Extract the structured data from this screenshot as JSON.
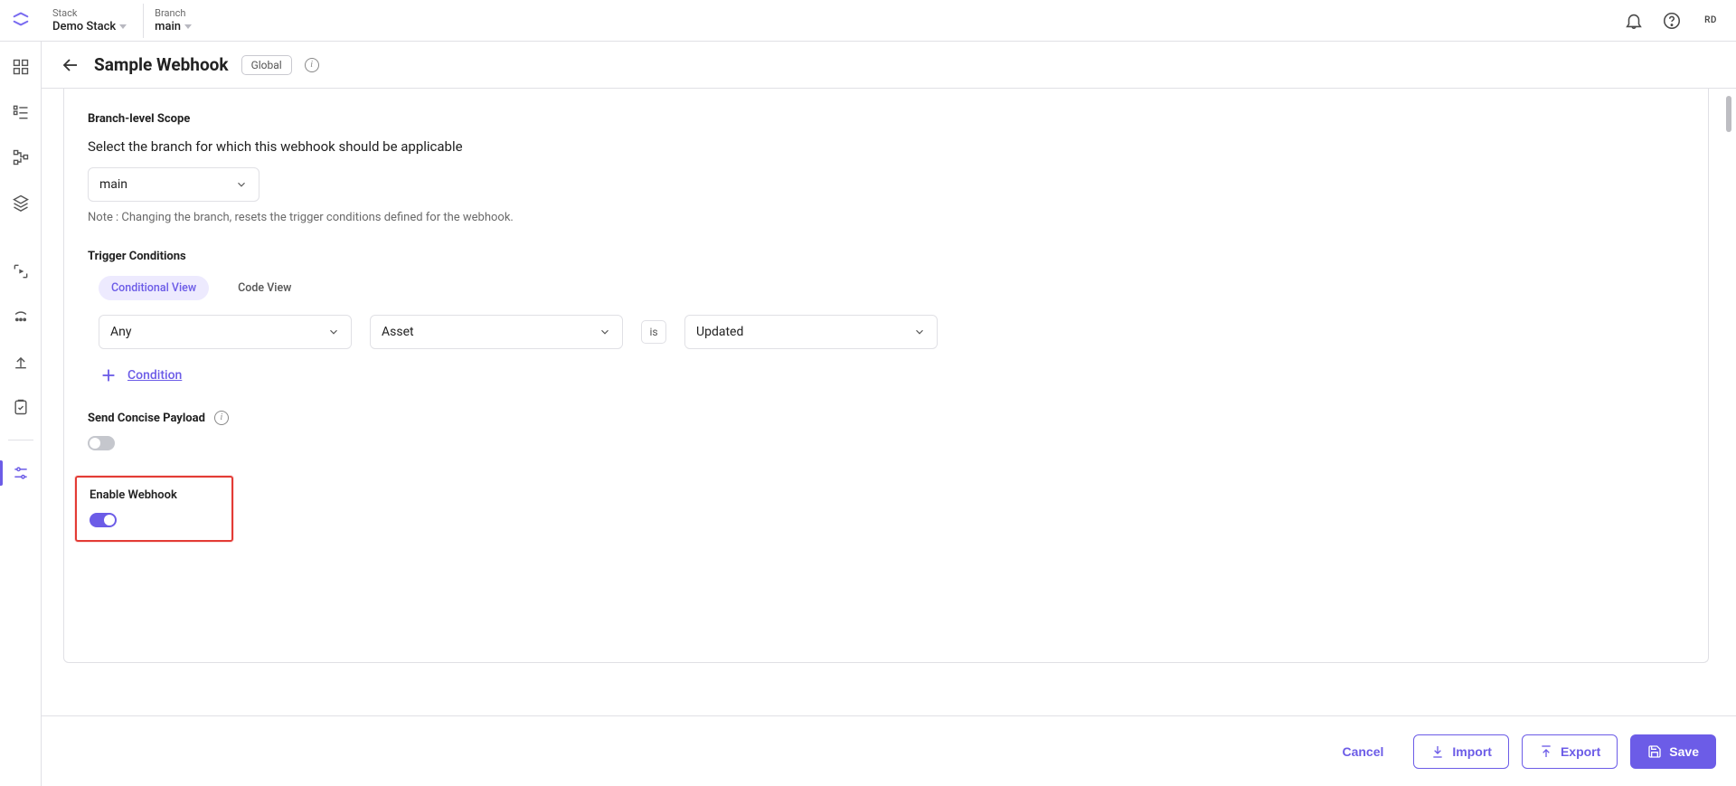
{
  "topbar": {
    "stack_label": "Stack",
    "stack_value": "Demo Stack",
    "branch_label": "Branch",
    "branch_value": "main",
    "avatar_initials": "RD"
  },
  "header": {
    "title": "Sample Webhook",
    "scope_badge": "Global"
  },
  "branch_scope": {
    "title": "Branch-level Scope",
    "description": "Select the branch for which this webhook should be applicable",
    "selected": "main",
    "note": "Note : Changing the branch, resets the trigger conditions defined for the webhook."
  },
  "trigger": {
    "title": "Trigger Conditions",
    "tabs": {
      "conditional": "Conditional View",
      "code": "Code View"
    },
    "row": {
      "scope": "Any",
      "entity": "Asset",
      "op": "is",
      "action": "Updated"
    },
    "add_label": "Condition"
  },
  "concise": {
    "title": "Send Concise Payload",
    "enabled": false
  },
  "enable": {
    "title": "Enable Webhook",
    "enabled": true
  },
  "footer": {
    "cancel": "Cancel",
    "import": "Import",
    "export": "Export",
    "save": "Save"
  },
  "icons": {
    "bell": "bell-icon",
    "help": "help-icon",
    "back": "back-icon",
    "info": "info-icon",
    "chevron": "chevron-down-icon",
    "plus": "plus-icon",
    "import": "import-icon",
    "export": "export-icon",
    "save": "save-icon",
    "brand": "brand-icon"
  }
}
